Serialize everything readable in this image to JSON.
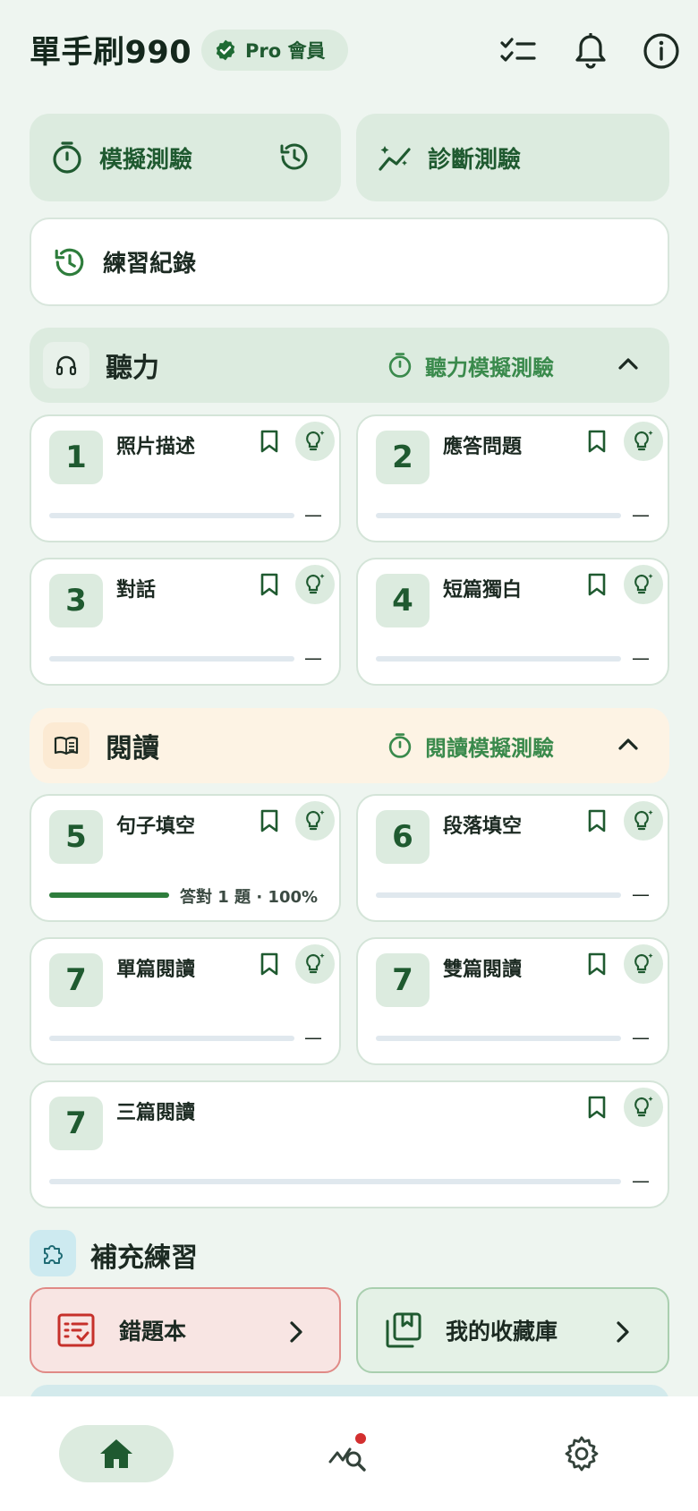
{
  "header": {
    "title": "單手刷990",
    "badge": "Pro 會員",
    "icons": [
      "checklist-icon",
      "bell-icon",
      "info-icon"
    ]
  },
  "top_tiles": {
    "mock_test": "模擬測驗",
    "diagnostic_test": "診斷測驗",
    "practice_history": "練習紀錄"
  },
  "listening": {
    "title": "聽力",
    "mock_link": "聽力模擬測驗",
    "parts": [
      {
        "number": "1",
        "name": "照片描述",
        "progress": "—",
        "progress_fraction": 0
      },
      {
        "number": "2",
        "name": "應答問題",
        "progress": "—",
        "progress_fraction": 0
      },
      {
        "number": "3",
        "name": "對話",
        "progress": "—",
        "progress_fraction": 0
      },
      {
        "number": "4",
        "name": "短篇獨白",
        "progress": "—",
        "progress_fraction": 0
      }
    ]
  },
  "reading": {
    "title": "閱讀",
    "mock_link": "閱讀模擬測驗",
    "parts": [
      {
        "number": "5",
        "name": "句子填空",
        "progress": "答對 1 題 · 100%",
        "progress_fraction": 1.0
      },
      {
        "number": "6",
        "name": "段落填空",
        "progress": "—",
        "progress_fraction": 0
      },
      {
        "number": "7",
        "name": "單篇閱讀",
        "progress": "—",
        "progress_fraction": 0
      },
      {
        "number": "7",
        "name": "雙篇閱讀",
        "progress": "—",
        "progress_fraction": 0
      },
      {
        "number": "7",
        "name": "三篇閱讀",
        "progress": "—",
        "progress_fraction": 0
      }
    ]
  },
  "supplement": {
    "title": "補充練習",
    "wrong_book": "錯題本",
    "favorites": "我的收藏庫"
  },
  "bottom_nav": {
    "items": [
      "home-icon",
      "analytics-icon",
      "settings-icon"
    ],
    "active": "home-icon",
    "analytics_has_notification": true
  },
  "colors": {
    "background": "#eef5f0",
    "primary_green": "#1f5a30",
    "accent_green": "#3a8a4c",
    "tile_green": "#dcebdf",
    "reading_section": "#fdf3e4",
    "wrong_book_bg": "#f8e5e3",
    "wrong_book_border": "#e08a86",
    "favorites_bg": "#e4f1e6",
    "notification_dot": "#d32f2f"
  }
}
